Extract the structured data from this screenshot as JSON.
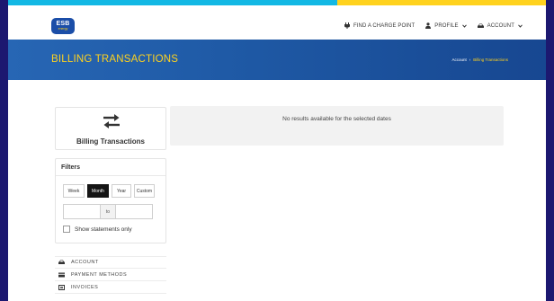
{
  "brand": {
    "logo_line1": "ESB",
    "logo_line2": "energy",
    "accent": "#ffd21e",
    "primary": "#1b4ea8"
  },
  "nav": {
    "find_charge": "FIND A CHARGE POINT",
    "profile": "PROFILE",
    "account": "ACCOUNT",
    "icons": [
      "plug-icon",
      "user-icon",
      "car-icon",
      "chevron-down-icon"
    ]
  },
  "banner": {
    "title": "BILLING TRANSACTIONS",
    "breadcrumb": {
      "parent": "Account",
      "separator": "›",
      "current": "Billing Transactions"
    }
  },
  "sidebar": {
    "card_title": "Billing Transactions",
    "filters": {
      "title": "Filters",
      "periods": [
        {
          "label": "Week",
          "active": false
        },
        {
          "label": "Month",
          "active": true
        },
        {
          "label": "Year",
          "active": false
        },
        {
          "label": "Custom",
          "active": false
        }
      ],
      "from_value": "",
      "to_label": "to",
      "to_value": "",
      "statements_label": "Show statements only",
      "statements_checked": false
    },
    "menu": [
      {
        "label": "ACCOUNT",
        "icon": "car-icon"
      },
      {
        "label": "PAYMENT METHODS",
        "icon": "credit-card-icon"
      },
      {
        "label": "INVOICES",
        "icon": "invoice-icon"
      }
    ]
  },
  "results": {
    "message": "No results available for the selected dates"
  }
}
